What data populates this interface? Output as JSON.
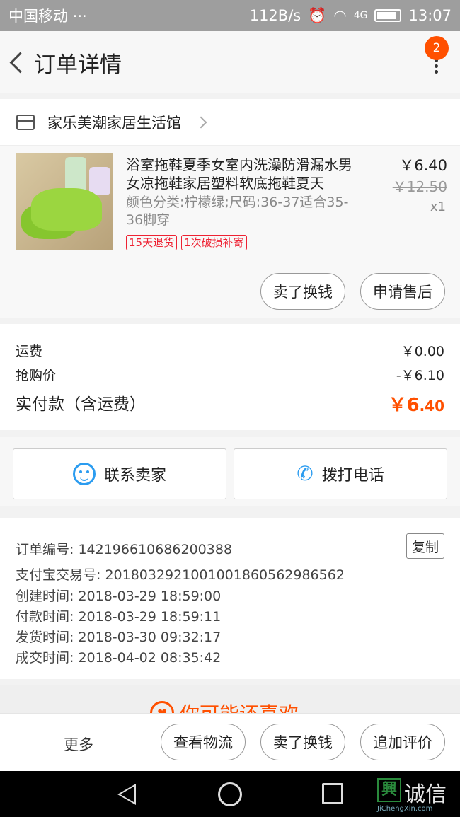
{
  "status_bar": {
    "carrier": "中国移动 ···",
    "speed": "112B/s",
    "network": "4G",
    "time": "13:07"
  },
  "header": {
    "title": "订单详情",
    "badge_count": "2"
  },
  "shop": {
    "name": "家乐美潮家居生活馆"
  },
  "item": {
    "title": "浴室拖鞋夏季女室内洗澡防滑漏水男女凉拖鞋家居塑料软底拖鞋夏天",
    "spec": "颜色分类:柠檬绿;尺码:36-37适合35-36脚穿",
    "tags": [
      "15天退货",
      "1次破损补寄"
    ],
    "price": "￥6.40",
    "original_price": "￥12.50",
    "quantity": "x1",
    "actions": {
      "sell": "卖了换钱",
      "after_sale": "申请售后"
    }
  },
  "costs": {
    "shipping_label": "运费",
    "shipping_value": "￥0.00",
    "discount_label": "抢购价",
    "discount_value": "-￥6.10",
    "total_label": "实付款（含运费）",
    "total_prefix": "￥6",
    "total_suffix": ".40"
  },
  "contact": {
    "seller": "联系卖家",
    "call": "拨打电话"
  },
  "order_info": {
    "order_no": "订单编号: 142196610686200388",
    "copy": "复制",
    "alipay_no": "支付宝交易号: 2018032921001001860562986562",
    "created": "创建时间: 2018-03-29 18:59:00",
    "paid": "付款时间: 2018-03-29 18:59:11",
    "shipped": "发货时间: 2018-03-30 09:32:17",
    "completed": "成交时间: 2018-04-02 08:35:42"
  },
  "guess": {
    "text": "你可能还喜欢"
  },
  "bottom_bar": {
    "more": "更多",
    "logistics": "查看物流",
    "sell": "卖了换钱",
    "review": "追加评价"
  },
  "watermark": {
    "brand": "诚信",
    "sub": "JiChengXin.com"
  },
  "colors": {
    "accent": "#ff5000",
    "link_blue": "#2b9cf0",
    "tag_red": "#e22233"
  }
}
